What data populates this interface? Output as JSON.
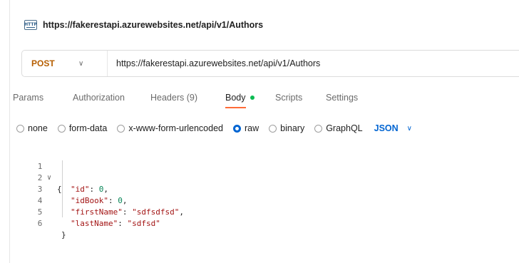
{
  "request": {
    "icon_name": "http-icon",
    "icon_text": "HTTP",
    "title": "https://fakerestapi.azurewebsites.net/api/v1/Authors"
  },
  "url_bar": {
    "method": "POST",
    "url": "https://fakerestapi.azurewebsites.net/api/v1/Authors"
  },
  "tabs": [
    "Params",
    "Authorization",
    "Headers (9)",
    "Body",
    "Scripts",
    "Settings"
  ],
  "body_options": {
    "modes": [
      "none",
      "form-data",
      "x-www-form-urlencoded",
      "raw",
      "binary",
      "GraphQL"
    ],
    "selected_mode": "raw",
    "format": "JSON"
  },
  "editor": {
    "line_numbers": [
      "1",
      "2",
      "3",
      "4",
      "5",
      "6"
    ],
    "line1_open": "{",
    "line2_key": "\"id\"",
    "line2_value": "0",
    "line3_key": "\"idBook\"",
    "line3_value": "0",
    "line4_key": "\"firstName\"",
    "line4_value": "\"sdfsdfsd\"",
    "line5_key": "\"lastName\"",
    "line5_value": "\"sdfsd\"",
    "line6_close": "}"
  },
  "colors": {
    "method_post": "#b65e00",
    "active_tab_underline": "#ff6c37",
    "body_indicator": "#0cbb52",
    "accent_blue": "#0265d2"
  }
}
